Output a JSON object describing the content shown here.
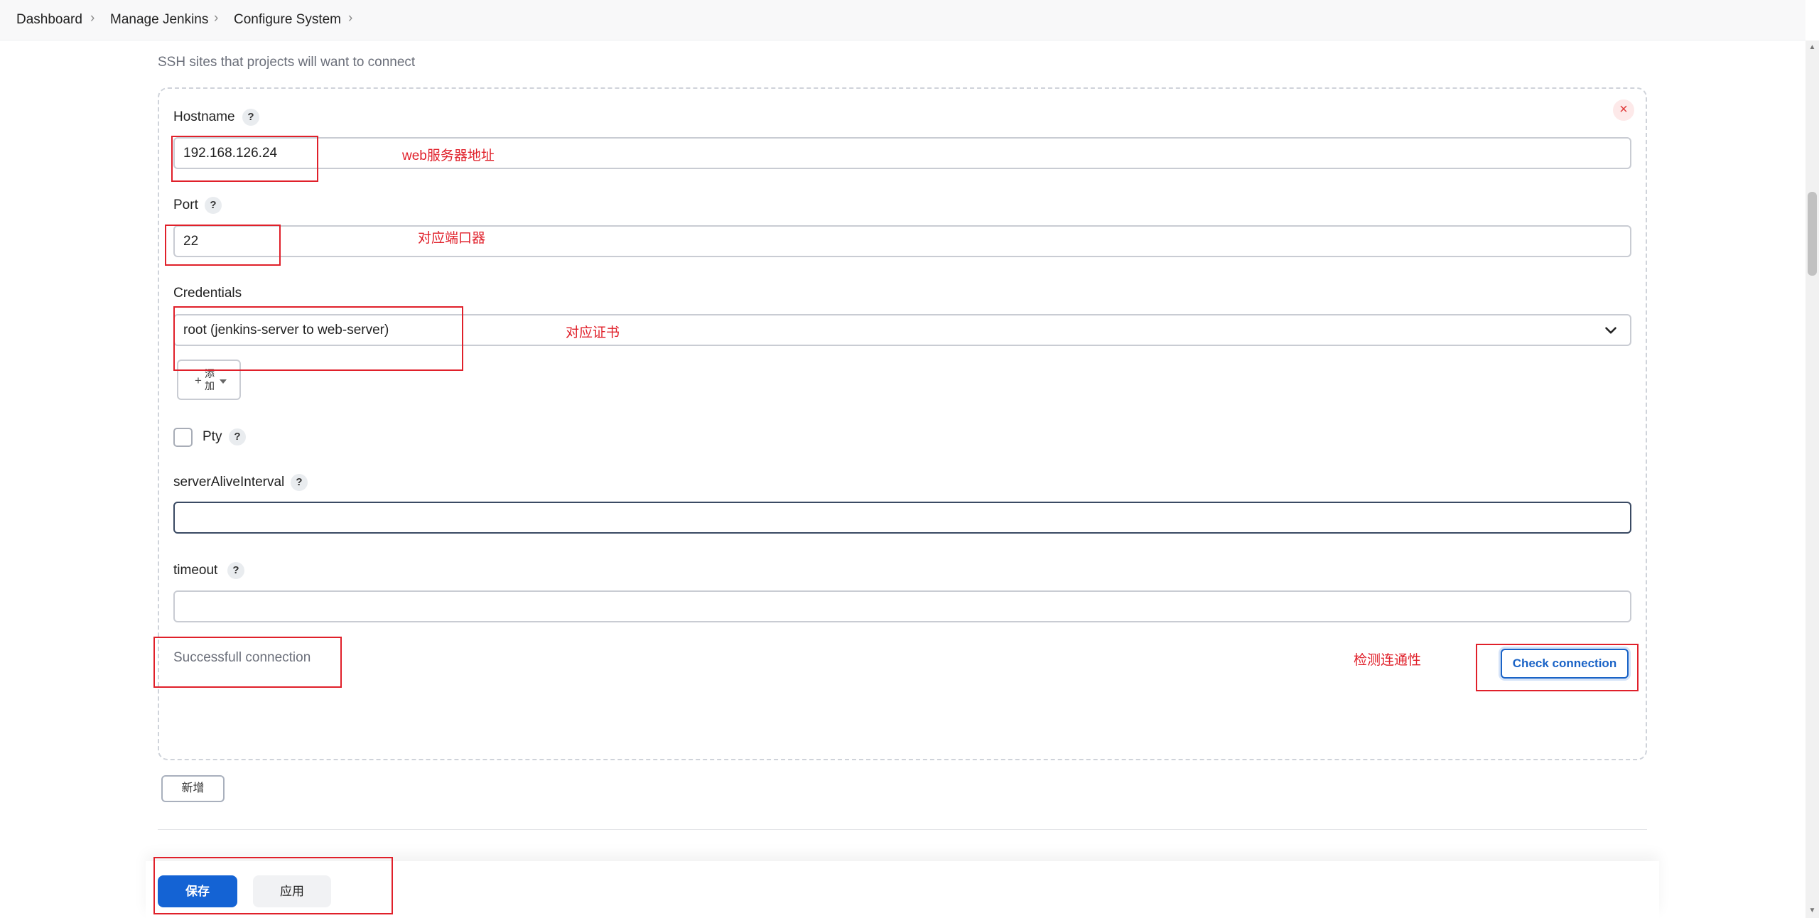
{
  "breadcrumb": {
    "items": [
      "Dashboard",
      "Manage Jenkins",
      "Configure System"
    ],
    "separator": "›"
  },
  "section": {
    "description": "SSH sites that projects will want to connect"
  },
  "form": {
    "hostname": {
      "label": "Hostname",
      "value": "192.168.126.24"
    },
    "port": {
      "label": "Port",
      "value": "22"
    },
    "credentials": {
      "label": "Credentials",
      "selected": "root (jenkins-server to web-server)",
      "add_label": "添加"
    },
    "pty": {
      "label": "Pty",
      "checked": false
    },
    "server_alive_interval": {
      "label": "serverAliveInterval",
      "value": ""
    },
    "timeout": {
      "label": "timeout",
      "value": ""
    },
    "help_glyph": "?",
    "close_glyph": "×",
    "status_text": "Successfull connection",
    "check_button": "Check connection"
  },
  "new_button": "新增",
  "footer": {
    "save": "保存",
    "apply": "应用"
  },
  "annotations": {
    "hostname": "web服务器地址",
    "port": "对应端口器",
    "credentials": "对应证书",
    "check": "检测连通性"
  },
  "colors": {
    "accent": "#1463d4",
    "annotation": "#e0202a"
  },
  "icons": [
    "chevron-right-icon",
    "help-icon",
    "close-icon",
    "chevron-down-icon",
    "plus-icon",
    "caret-down-icon"
  ]
}
